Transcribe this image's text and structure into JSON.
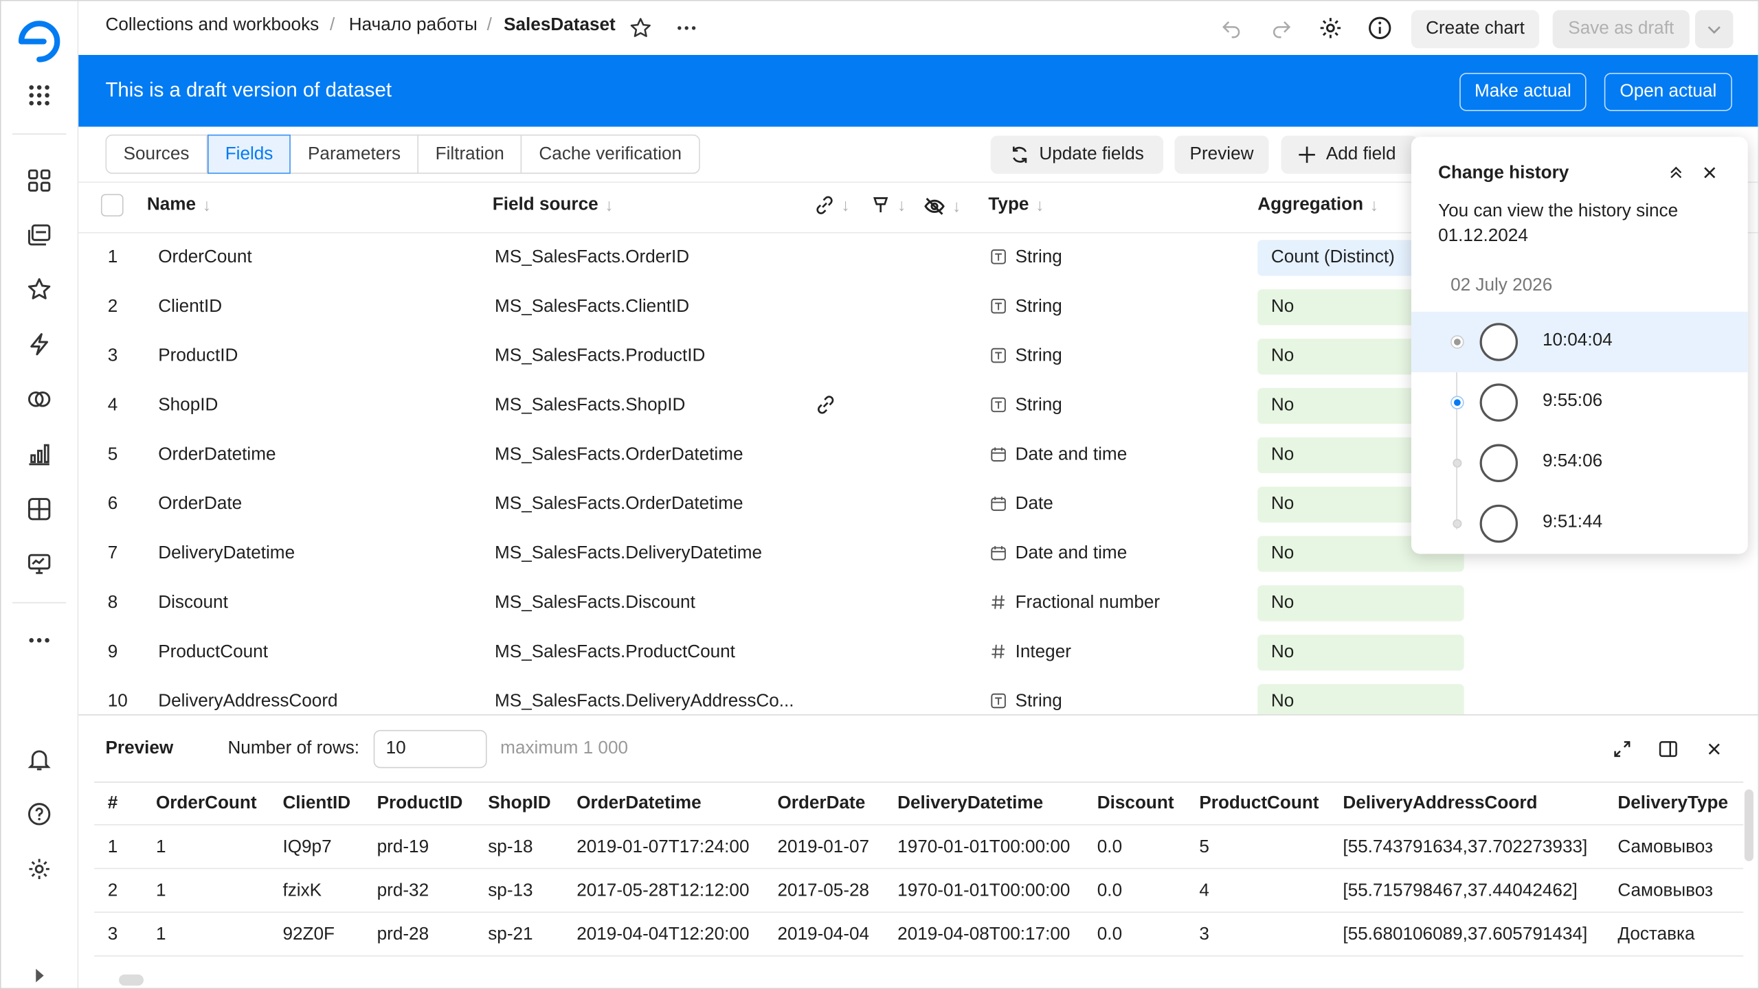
{
  "breadcrumbs": [
    "Collections and workbooks",
    "Начало работы",
    "SalesDataset"
  ],
  "header": {
    "create_chart": "Create chart",
    "save_as_draft": "Save as draft"
  },
  "banner": {
    "text": "This is a draft version of dataset",
    "make_actual": "Make actual",
    "open_actual": "Open actual"
  },
  "tabs": [
    "Sources",
    "Fields",
    "Parameters",
    "Filtration",
    "Cache verification"
  ],
  "active_tab": "Fields",
  "toolbar": {
    "update_fields": "Update fields",
    "preview": "Preview",
    "add_field": "Add field"
  },
  "columns": {
    "name": "Name",
    "field_source": "Field source",
    "type": "Type",
    "aggregation": "Aggregation"
  },
  "fields": [
    {
      "num": "1",
      "name": "OrderCount",
      "source": "MS_SalesFacts.OrderID",
      "type": "String",
      "type_icon": "text-icon",
      "agg": "Count (Distinct)",
      "link": false
    },
    {
      "num": "2",
      "name": "ClientID",
      "source": "MS_SalesFacts.ClientID",
      "type": "String",
      "type_icon": "text-icon",
      "agg": "No",
      "link": false
    },
    {
      "num": "3",
      "name": "ProductID",
      "source": "MS_SalesFacts.ProductID",
      "type": "String",
      "type_icon": "text-icon",
      "agg": "No",
      "link": false
    },
    {
      "num": "4",
      "name": "ShopID",
      "source": "MS_SalesFacts.ShopID",
      "type": "String",
      "type_icon": "text-icon",
      "agg": "No",
      "link": true
    },
    {
      "num": "5",
      "name": "OrderDatetime",
      "source": "MS_SalesFacts.OrderDatetime",
      "type": "Date and time",
      "type_icon": "calendar-icon",
      "agg": "No",
      "link": false
    },
    {
      "num": "6",
      "name": "OrderDate",
      "source": "MS_SalesFacts.OrderDatetime",
      "type": "Date",
      "type_icon": "calendar-icon",
      "agg": "No",
      "link": false
    },
    {
      "num": "7",
      "name": "DeliveryDatetime",
      "source": "MS_SalesFacts.DeliveryDatetime",
      "type": "Date and time",
      "type_icon": "calendar-icon",
      "agg": "No",
      "link": false
    },
    {
      "num": "8",
      "name": "Discount",
      "source": "MS_SalesFacts.Discount",
      "type": "Fractional number",
      "type_icon": "hash-icon",
      "agg": "No",
      "link": false
    },
    {
      "num": "9",
      "name": "ProductCount",
      "source": "MS_SalesFacts.ProductCount",
      "type": "Integer",
      "type_icon": "hash-icon",
      "agg": "No",
      "link": false
    },
    {
      "num": "10",
      "name": "DeliveryAddressCoord",
      "source": "MS_SalesFacts.DeliveryAddressCo...",
      "type": "String",
      "type_icon": "text-icon",
      "agg": "No",
      "link": false
    }
  ],
  "history": {
    "title": "Change history",
    "note": "You can view the history since 01.12.2024",
    "date": "02 July 2026",
    "items": [
      {
        "time": "10:04:04",
        "selected": true,
        "current": false
      },
      {
        "time": "9:55:06",
        "selected": false,
        "current": true
      },
      {
        "time": "9:54:06",
        "selected": false,
        "current": false
      },
      {
        "time": "9:51:44",
        "selected": false,
        "current": false
      }
    ]
  },
  "preview": {
    "title": "Preview",
    "rows_label": "Number of rows:",
    "rows_value": "10",
    "max_note": "maximum 1 000",
    "headers": [
      "#",
      "OrderCount",
      "ClientID",
      "ProductID",
      "ShopID",
      "OrderDatetime",
      "OrderDate",
      "DeliveryDatetime",
      "Discount",
      "ProductCount",
      "DeliveryAddressCoord",
      "DeliveryType"
    ],
    "rows": [
      [
        "1",
        "1",
        "IQ9p7",
        "prd-19",
        "sp-18",
        "2019-01-07T17:24:00",
        "2019-01-07",
        "1970-01-01T00:00:00",
        "0.0",
        "5",
        "[55.743791634,37.702273933]",
        "Самовывоз"
      ],
      [
        "2",
        "1",
        "fzixK",
        "prd-32",
        "sp-13",
        "2017-05-28T12:12:00",
        "2017-05-28",
        "1970-01-01T00:00:00",
        "0.0",
        "4",
        "[55.715798467,37.44042462]",
        "Самовывоз"
      ],
      [
        "3",
        "1",
        "92Z0F",
        "prd-28",
        "sp-21",
        "2019-04-04T12:20:00",
        "2019-04-04",
        "2019-04-08T00:17:00",
        "0.0",
        "3",
        "[55.680106089,37.605791434]",
        "Доставка"
      ]
    ]
  },
  "colors": {
    "accent": "#027bf3",
    "agg_green": "#e7f6e2",
    "agg_blue": "#e5f1fd"
  }
}
